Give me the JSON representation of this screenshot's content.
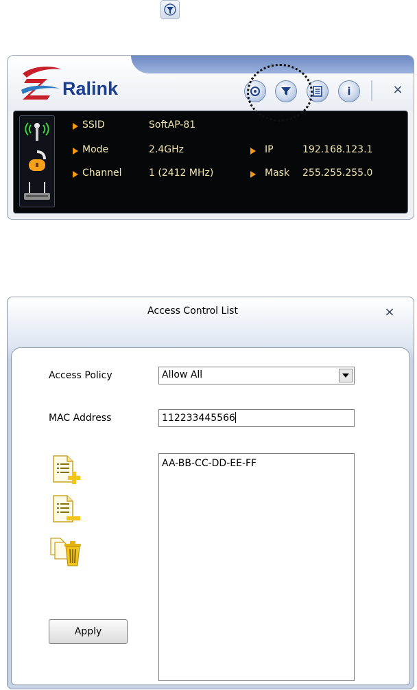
{
  "ralink": {
    "logo_text": "Ralink",
    "toolbar": {
      "buttons": [
        {
          "icon": "site-survey-icon"
        },
        {
          "icon": "filter-icon"
        },
        {
          "icon": "list-icon"
        },
        {
          "icon": "info-icon",
          "glyph": "i"
        }
      ],
      "close_glyph": "×"
    },
    "info": {
      "ssid_label": "SSID",
      "ssid_value": "SoftAP-81",
      "mode_label": "Mode",
      "mode_value": "2.4GHz",
      "channel_label": "Channel",
      "channel_value": "1 (2412 MHz)",
      "ip_label": "IP",
      "ip_value": "192.168.123.1",
      "mask_label": "Mask",
      "mask_value": "255.255.255.0"
    }
  },
  "acl": {
    "title": "Access Control List",
    "close_glyph": "×",
    "access_policy_label": "Access Policy",
    "access_policy_value": "Allow All",
    "mac_address_label": "MAC Address",
    "mac_address_value": "112233445566",
    "mac_list": [
      "AA-BB-CC-DD-EE-FF"
    ],
    "apply_label": "Apply"
  },
  "colors": {
    "panel_bg": "#050709",
    "info_text": "#f2e7b0",
    "arrow": "#f29a13",
    "brand_blue": "#1b3f93"
  }
}
